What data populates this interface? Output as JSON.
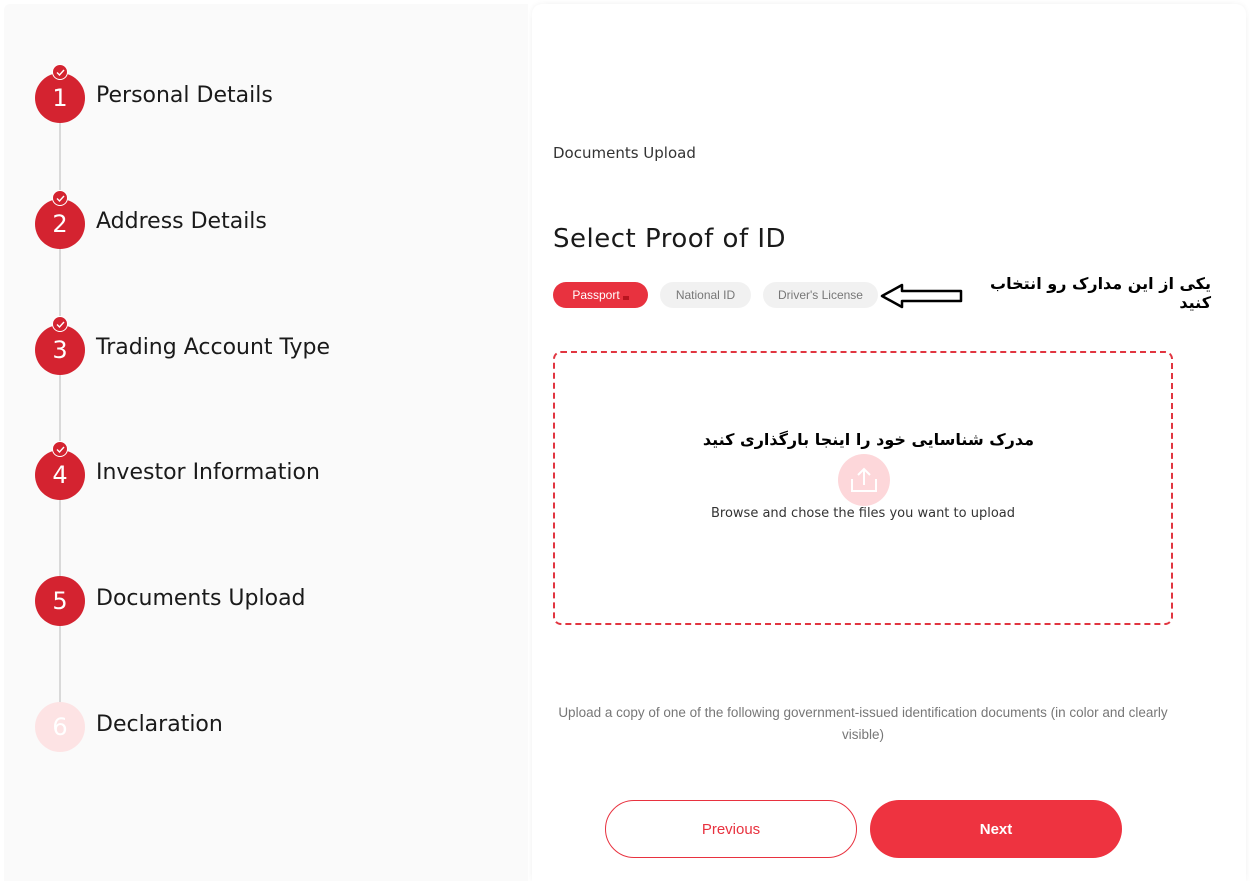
{
  "steps": [
    {
      "number": "1",
      "label": "Personal Details",
      "status": "completed"
    },
    {
      "number": "2",
      "label": "Address Details",
      "status": "completed"
    },
    {
      "number": "3",
      "label": "Trading Account Type",
      "status": "completed"
    },
    {
      "number": "4",
      "label": "Investor Information",
      "status": "completed"
    },
    {
      "number": "5",
      "label": "Documents Upload",
      "status": "current"
    },
    {
      "number": "6",
      "label": "Declaration",
      "status": "pending"
    }
  ],
  "main": {
    "section_caption": "Documents Upload",
    "title": "Select Proof of ID",
    "id_options": [
      {
        "label": "Passport",
        "selected": true
      },
      {
        "label": "National ID",
        "selected": false
      },
      {
        "label": "Driver's License",
        "selected": false
      }
    ],
    "annotation_select": "یکی از این مدارک رو انتخاب کنید",
    "dropzone": {
      "annotation": "مدرک شناسایی خود را اینجا بارگذاری کنید",
      "hint": "Browse and chose the files you want to upload"
    },
    "info": "Upload a copy of one of the following government-issued identification documents (in color and clearly visible)"
  },
  "buttons": {
    "previous": "Previous",
    "next": "Next"
  },
  "colors": {
    "accent": "#e8323f",
    "step_active": "#d42330",
    "step_pending": "#fde3e4"
  }
}
